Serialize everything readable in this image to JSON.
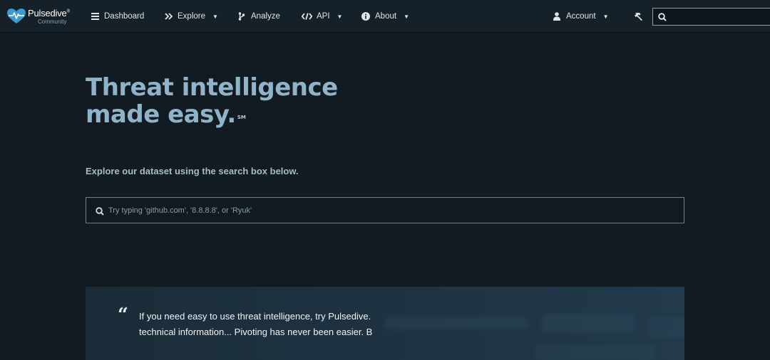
{
  "brand": {
    "name": "Pulsedive",
    "trademark": "®",
    "edition": "Community",
    "logo_icon": "heart-pulse-icon"
  },
  "nav": {
    "dashboard": {
      "label": "Dashboard",
      "icon": "list-icon"
    },
    "explore": {
      "label": "Explore",
      "icon": "double-chevron-right-icon"
    },
    "analyze": {
      "label": "Analyze",
      "icon": "branch-icon"
    },
    "api": {
      "label": "API",
      "icon": "code-icon"
    },
    "about": {
      "label": "About",
      "icon": "info-circle-icon"
    },
    "account": {
      "label": "Account",
      "icon": "user-icon"
    },
    "tools_icon": "hammer-icon"
  },
  "top_search": {
    "placeholder": "",
    "value": ""
  },
  "hero": {
    "title_line1": "Threat intelligence",
    "title_line2": "made easy.",
    "service_mark": "SM",
    "subtitle": "Explore our dataset using the search box below.",
    "search_placeholder": "Try typing 'github.com', '8.8.8.8', or 'Ryuk'"
  },
  "testimonial": {
    "quote_mark": "“",
    "line1": "If you need easy to use threat intelligence, try Pulsedive.",
    "line2": "technical information... Pivoting has never been easier. B"
  },
  "colors": {
    "background": "#121b21",
    "navbar": "#152029",
    "hero_title": "#8fb3c9",
    "brand_blue": "#3d9bd1"
  }
}
